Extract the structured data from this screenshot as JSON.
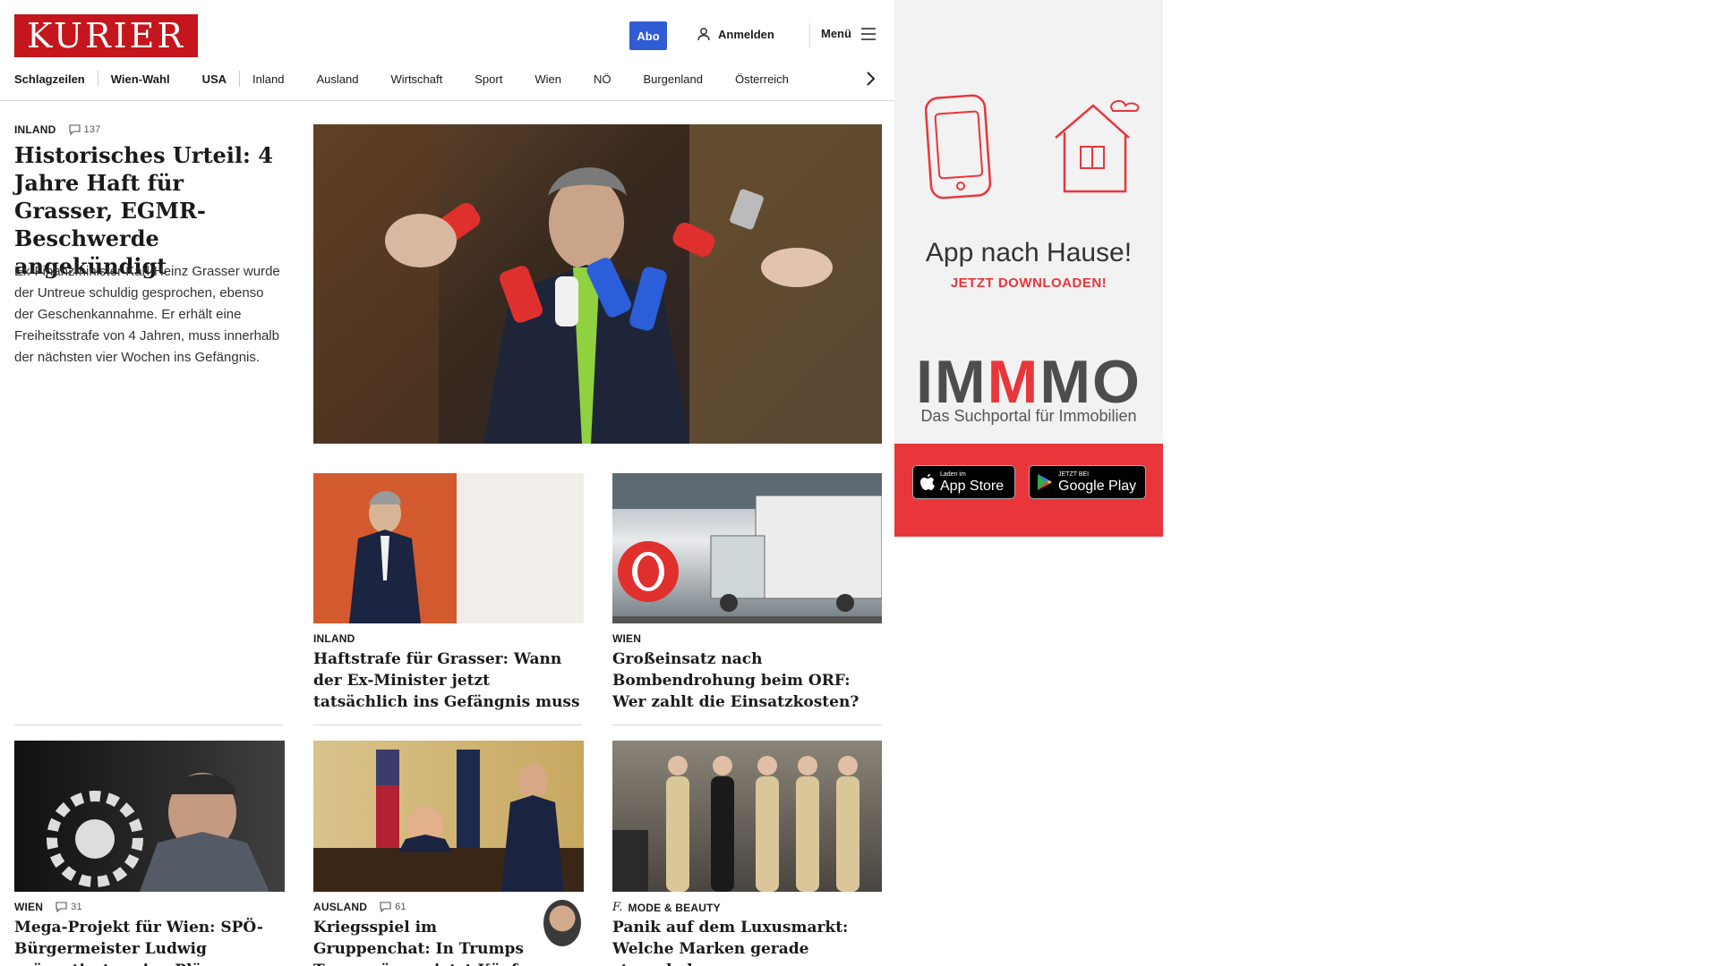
{
  "header": {
    "logo": "KURIER",
    "abo_label": "Abo",
    "login_label": "Anmelden",
    "menu_label": "Menü"
  },
  "nav": {
    "items": [
      "Schlagzeilen",
      "Wien-Wahl",
      "USA",
      "Inland",
      "Ausland",
      "Wirtschaft",
      "Sport",
      "Wien",
      "NÖ",
      "Burgenland",
      "Österreich"
    ]
  },
  "lead": {
    "category": "INLAND",
    "comments": "137",
    "title": "Historisches Urteil: 4 Jahre Haft für Grasser, EGMR-Beschwerde angekündigt",
    "teaser": "Ex-Finanzminister Karl-Heinz Grasser wurde der Untreue schuldig gesprochen, ebenso der Geschenkannahme. Er erhält eine Freiheitsstrafe von 4 Jahren, muss innerhalb der nächsten vier Wochen ins Gefängnis."
  },
  "cards": [
    {
      "category": "INLAND",
      "title": "Haftstrafe für Grasser: Wann der Ex-Minister jetzt tatsächlich ins Gefängnis muss"
    },
    {
      "category": "WIEN",
      "title": "Großeinsatz nach Bombendrohung beim ORF: Wer zahlt die Einsatzkosten?"
    },
    {
      "category": "WIEN",
      "comments": "31",
      "title": "Mega-Projekt für Wien: SPÖ-Bürgermeister Ludwig präsentierte seine Pläne"
    },
    {
      "category": "AUSLAND",
      "comments": "61",
      "title": "Kriegsspiel im Gruppenchat: In Trumps Team müssen jetzt Köpfe rollen"
    },
    {
      "category": "MODE & BEAUTY",
      "title": "Panik auf dem Luxusmarkt: Welche Marken gerade straucheln"
    }
  ],
  "ad": {
    "title": "App nach Hause!",
    "subtitle": "JETZT DOWNLOADEN!",
    "brand": "IMMMO",
    "tagline": "Das Suchportal für Immobilien",
    "appstore_small": "Laden im",
    "appstore_big": "App Store",
    "play_small": "JETZT BEI",
    "play_big": "Google Play"
  },
  "colors": {
    "brand_red": "#c4161c",
    "abo_blue": "#2f5bd3",
    "ad_red": "#e8363b"
  }
}
